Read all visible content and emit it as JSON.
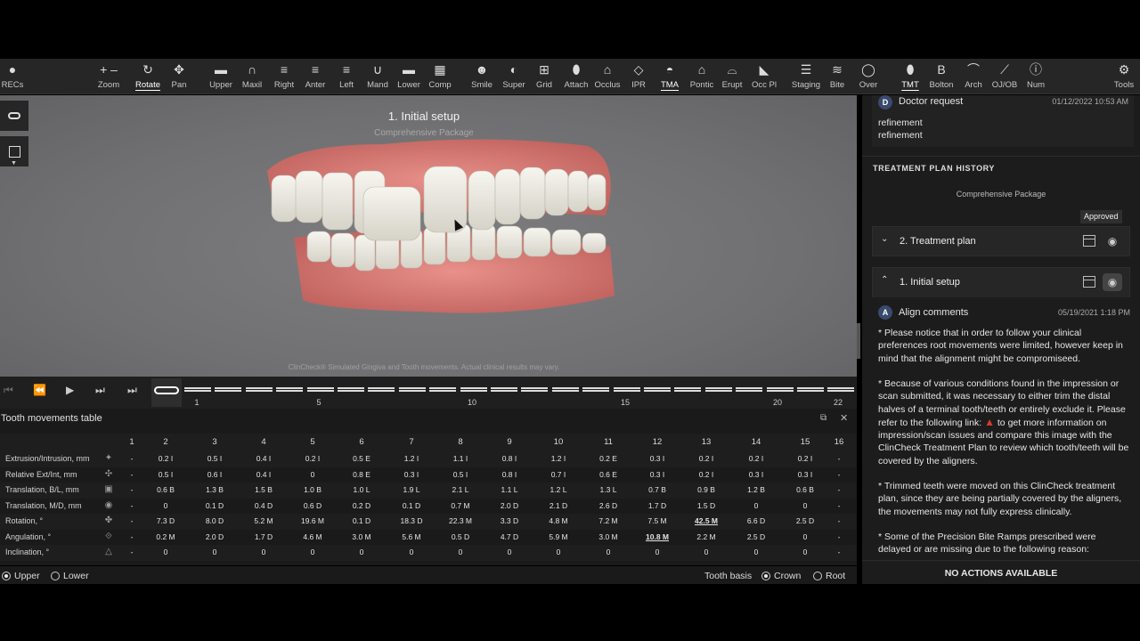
{
  "toolbar": {
    "items": [
      {
        "id": "recs",
        "label": "RECs",
        "icon": "person-icon",
        "glyph": "●"
      },
      {
        "id": "zoom",
        "label": "Zoom",
        "icon": "zoom-icon",
        "glyph": "+ –"
      },
      {
        "id": "rotate",
        "label": "Rotate",
        "icon": "rotate-icon",
        "glyph": "↻",
        "active": true
      },
      {
        "id": "pan",
        "label": "Pan",
        "icon": "pan-icon",
        "glyph": "✥"
      },
      {
        "id": "upper",
        "label": "Upper",
        "icon": "upper-view-icon",
        "glyph": "▬"
      },
      {
        "id": "maxil",
        "label": "Maxil",
        "icon": "maxillary-icon",
        "glyph": "∩"
      },
      {
        "id": "right",
        "label": "Right",
        "icon": "right-view-icon",
        "glyph": "≡"
      },
      {
        "id": "anter",
        "label": "Anter",
        "icon": "anterior-view-icon",
        "glyph": "≡"
      },
      {
        "id": "left",
        "label": "Left",
        "icon": "left-view-icon",
        "glyph": "≡"
      },
      {
        "id": "mand",
        "label": "Mand",
        "icon": "mandibular-icon",
        "glyph": "∪"
      },
      {
        "id": "lower",
        "label": "Lower",
        "icon": "lower-view-icon",
        "glyph": "▬"
      },
      {
        "id": "comp",
        "label": "Comp",
        "icon": "compare-icon",
        "glyph": "▦"
      },
      {
        "id": "smile",
        "label": "Smile",
        "icon": "smile-icon",
        "glyph": "☻"
      },
      {
        "id": "super",
        "label": "Super",
        "icon": "superimpose-icon",
        "glyph": "◐"
      },
      {
        "id": "grid",
        "label": "Grid",
        "icon": "grid-icon",
        "glyph": "⊞"
      },
      {
        "id": "attach",
        "label": "Attach",
        "icon": "attachment-icon",
        "glyph": "⬮"
      },
      {
        "id": "occlus",
        "label": "Occlus",
        "icon": "occlusion-icon",
        "glyph": "⌂"
      },
      {
        "id": "ipr",
        "label": "IPR",
        "icon": "ipr-icon",
        "glyph": "◇"
      },
      {
        "id": "tma",
        "label": "TMA",
        "icon": "tma-icon",
        "glyph": "◓",
        "active": true
      },
      {
        "id": "pontic",
        "label": "Pontic",
        "icon": "pontic-icon",
        "glyph": "⌂"
      },
      {
        "id": "erupt",
        "label": "Erupt",
        "icon": "erupt-icon",
        "glyph": "⌓"
      },
      {
        "id": "occpl",
        "label": "Occ Pl",
        "icon": "occlusal-plane-icon",
        "glyph": "◣"
      },
      {
        "id": "staging",
        "label": "Staging",
        "icon": "staging-icon",
        "glyph": "☰"
      },
      {
        "id": "bite",
        "label": "Bite",
        "icon": "bite-icon",
        "glyph": "≋"
      },
      {
        "id": "over",
        "label": "Over",
        "icon": "overlay-icon",
        "glyph": "◯"
      },
      {
        "id": "tmt",
        "label": "TMT",
        "icon": "tmt-icon",
        "glyph": "⬮",
        "active": true
      },
      {
        "id": "bolton",
        "label": "Bolton",
        "icon": "bolton-icon",
        "glyph": "B"
      },
      {
        "id": "arch",
        "label": "Arch",
        "icon": "arch-icon",
        "glyph": "⌒"
      },
      {
        "id": "ojob",
        "label": "OJ/OB",
        "icon": "ojob-icon",
        "glyph": "⟋"
      },
      {
        "id": "num",
        "label": "Num",
        "icon": "numbering-icon",
        "glyph": "ⓘ"
      },
      {
        "id": "tools",
        "label": "Tools",
        "icon": "gear-icon",
        "glyph": "⚙"
      }
    ]
  },
  "viewport": {
    "title": "1. Initial setup",
    "subtitle": "Comprehensive Package",
    "disclaimer": "ClinCheck® Simulated Gingiva and Tooth movements. Actual clinical results may vary."
  },
  "timeline": {
    "stage_labels": [
      "1",
      "5",
      "10",
      "15",
      "20",
      "22"
    ]
  },
  "tmt": {
    "title": "Tooth movements table",
    "columns": [
      "1",
      "2",
      "3",
      "4",
      "5",
      "6",
      "7",
      "8",
      "9",
      "10",
      "11",
      "12",
      "13",
      "14",
      "15",
      "16"
    ],
    "rows": [
      {
        "label": "Extrusion/Intrusion, mm",
        "values": [
          "-",
          "0.2 I",
          "0.5 I",
          "0.4 I",
          "0.2 I",
          "0.5 E",
          "1.2 I",
          "1.1 I",
          "0.8 I",
          "1.2 I",
          "0.2 E",
          "0.3 I",
          "0.2 I",
          "0.2 I",
          "0.2 I",
          "-"
        ]
      },
      {
        "label": "Relative Ext/Int, mm",
        "values": [
          "-",
          "0.5 I",
          "0.6 I",
          "0.4 I",
          "0",
          "0.8 E",
          "0.3 I",
          "0.5 I",
          "0.8 I",
          "0.7 I",
          "0.6 E",
          "0.3 I",
          "0.2 I",
          "0.3 I",
          "0.3 I",
          "-"
        ]
      },
      {
        "label": "Translation, B/L, mm",
        "values": [
          "-",
          "0.6 B",
          "1.3 B",
          "1.5 B",
          "1.0 B",
          "1.0 L",
          "1.9 L",
          "2.1 L",
          "1.1 L",
          "1.2 L",
          "1.3 L",
          "0.7 B",
          "0.9 B",
          "1.2 B",
          "0.6 B",
          "-"
        ]
      },
      {
        "label": "Translation, M/D, mm",
        "values": [
          "-",
          "0",
          "0.1 D",
          "0.4 D",
          "0.6 D",
          "0.2 D",
          "0.1 D",
          "0.7 M",
          "2.0 D",
          "2.1 D",
          "2.6 D",
          "1.7 D",
          "1.5 D",
          "0",
          "0",
          "-"
        ]
      },
      {
        "label": "Rotation, °",
        "values": [
          "-",
          "7.3 D",
          "8.0 D",
          "5.2 M",
          "19.6 M",
          "0.1 D",
          "18.3 D",
          "22.3 M",
          "3.3 D",
          "4.8 M",
          "7.2 M",
          "7.5 M",
          "42.5 M",
          "6.6 D",
          "2.5 D",
          "-"
        ]
      },
      {
        "label": "Angulation, °",
        "values": [
          "-",
          "0.2 M",
          "2.0 D",
          "1.7 D",
          "4.6 M",
          "3.0 M",
          "5.6 M",
          "0.5 D",
          "4.7 D",
          "5.9 M",
          "3.0 M",
          "10.8 M",
          "2.2 M",
          "2.5 D",
          "0",
          "-"
        ]
      },
      {
        "label": "Inclination, °",
        "values": [
          "-",
          "0",
          "0",
          "0",
          "0",
          "0",
          "0",
          "0",
          "0",
          "0",
          "0",
          "0",
          "0",
          "0",
          "0",
          "-"
        ]
      }
    ],
    "underlined": [
      "4.12",
      "5.11"
    ]
  },
  "bottombar": {
    "upper": "Upper",
    "lower": "Lower",
    "tooth_basis": "Tooth basis",
    "crown": "Crown",
    "root": "Root"
  },
  "right_panel": {
    "doctor_request": {
      "avatar": "D",
      "title": "Doctor request",
      "date": "01/12/2022 10:53 AM",
      "lines": [
        "refinement",
        "refinement"
      ]
    },
    "history_title": "TREATMENT PLAN HISTORY",
    "package": "Comprehensive Package",
    "approved": "Approved",
    "plans": [
      {
        "label": "2. Treatment plan",
        "chevron": "⌄"
      },
      {
        "label": "1. Initial setup",
        "chevron": "⌃"
      }
    ],
    "align_comments": {
      "avatar": "A",
      "title": "Align comments",
      "date": "05/19/2021 1:18 PM",
      "p1": "* Please notice that in order to follow your clinical preferences root movements were limited, however keep in mind that the alignment might be compromiseed.",
      "p2a": "* Because of various conditions found in the impression or scan submitted, it was necessary to either trim the distal halves of a terminal tooth/teeth or entirely exclude it. Please refer to the following link:",
      "p2b": "to get more information on impression/scan issues and compare this image with the ClinCheck Treatment Plan to review which tooth/teeth will be covered by the aligners.",
      "p3": "* Trimmed teeth were moved on this ClinCheck treatment plan, since they are being partially covered by the aligners, the movements may not fully express clinically.",
      "p4": "* Some of the Precision Bite Ramps prescribed were delayed or are missing due to the following reason:"
    },
    "no_actions": "NO ACTIONS AVAILABLE"
  },
  "colors": {
    "accent": "#4bb6b6",
    "warning": "#d23c2c",
    "gum": "#d97f78",
    "tooth": "#ecebe4"
  }
}
